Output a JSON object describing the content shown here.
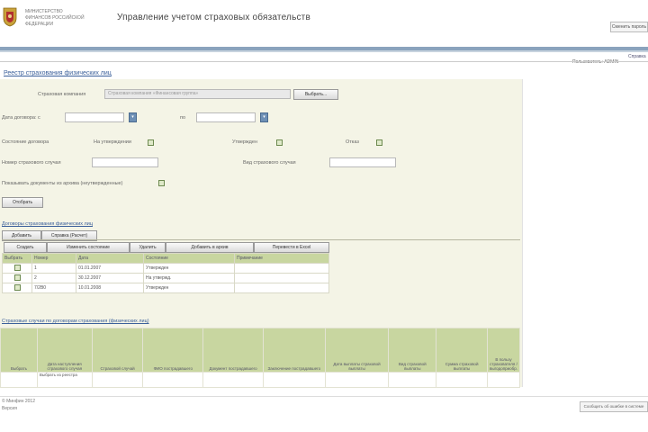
{
  "header": {
    "org_lines": [
      "МИНИСТЕРСТВО",
      "ФИНАНСОВ РОССИЙСКОЙ ФЕДЕРАЦИИ"
    ],
    "title": "Управление учетом страховых обязательств",
    "logout_label": "Сменить пароль",
    "help_label": "Справка",
    "user_line": "Пользователь: ADMIN"
  },
  "page": {
    "title": "Реестр страхования физических лиц"
  },
  "filters": {
    "insurer_label": "Страховая компания",
    "insurer_value": "Страховая компания «Финансовая группа»",
    "select_button": "Выбрать...",
    "date_from_label": "Дата договора: с",
    "date_to_label": "по",
    "state_label": "Состояние договора",
    "state_options": [
      "На утверждении",
      "Утвержден",
      "Отказ"
    ],
    "number_from_label": "Номер страхового случая",
    "number_to_label": "Вид страхового случая",
    "show_archived_label": "Показывать документы из архива (неутвержденные)",
    "apply_button": "Отобрать"
  },
  "contracts": {
    "title": "Договоры страхования физических лиц",
    "tabs": [
      "Добавить",
      "Справка (Расчет)"
    ],
    "actions": [
      "Создать",
      "Изменить состояние",
      "Удалить",
      "Добавить в архив",
      "Перевести в Excel"
    ],
    "columns": [
      "Выбрать",
      "Номер",
      "Дата",
      "Состояние",
      "Примечание"
    ],
    "rows": [
      {
        "number": "1",
        "date": "01.01.2007",
        "state": "Утвержден",
        "note": ""
      },
      {
        "number": "2",
        "date": "30.12.2007",
        "state": "На утвержд.",
        "note": ""
      },
      {
        "number": "7/2В0",
        "date": "10.01.2008",
        "state": "Утвержден",
        "note": ""
      }
    ]
  },
  "events": {
    "title": "Страховые случаи по договорам страхования (физических лиц)",
    "columns": [
      "Выбрать",
      "Дата наступления страхового случая",
      "Страховой случай",
      "ФИО пострадавшего",
      "Документ пострадавшего",
      "Заключение пострадавшего",
      "Дата выплаты страховой выплаты",
      "Вид страховой выплаты",
      "Сумма страховой выплаты",
      "В пользу страхователя / выгодоприобр."
    ],
    "rows": [
      {
        "cells": [
          "",
          "Выбрать из реестра",
          "",
          "",
          "",
          "",
          "",
          "",
          "",
          ""
        ]
      }
    ]
  },
  "footer": {
    "line1": "© Минфин 2012",
    "line2": "Версия",
    "button": "Сообщить об ошибке в системе"
  },
  "colors": {
    "accent": "#3a5f9a",
    "panel_bg": "#f4f4e6",
    "grid_header": "#c8d6a0",
    "top_bar": "#8aa3bd"
  }
}
